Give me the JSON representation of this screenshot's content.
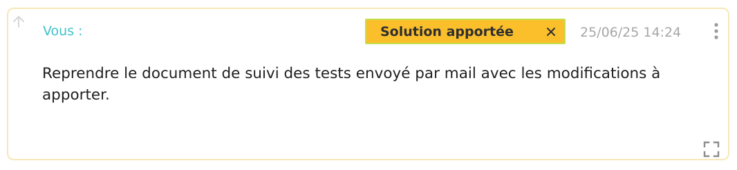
{
  "comment": {
    "author": "Vous :",
    "status_badge": {
      "label": "Solution apportée",
      "background": "#fbbf2b",
      "border": "#c3df4a"
    },
    "timestamp": "25/06/25 14:24",
    "message": "Reprendre le document de suivi des tests envoyé par mail avec les modifications à apporter.",
    "icons": {
      "up": "arrow-up-icon",
      "close": "close-icon",
      "menu": "more-vertical-icon",
      "expand": "expand-icon"
    },
    "colors": {
      "author": "#3fc1c9",
      "card_border": "#f8e6b6",
      "timestamp": "#a6a6a6"
    }
  }
}
